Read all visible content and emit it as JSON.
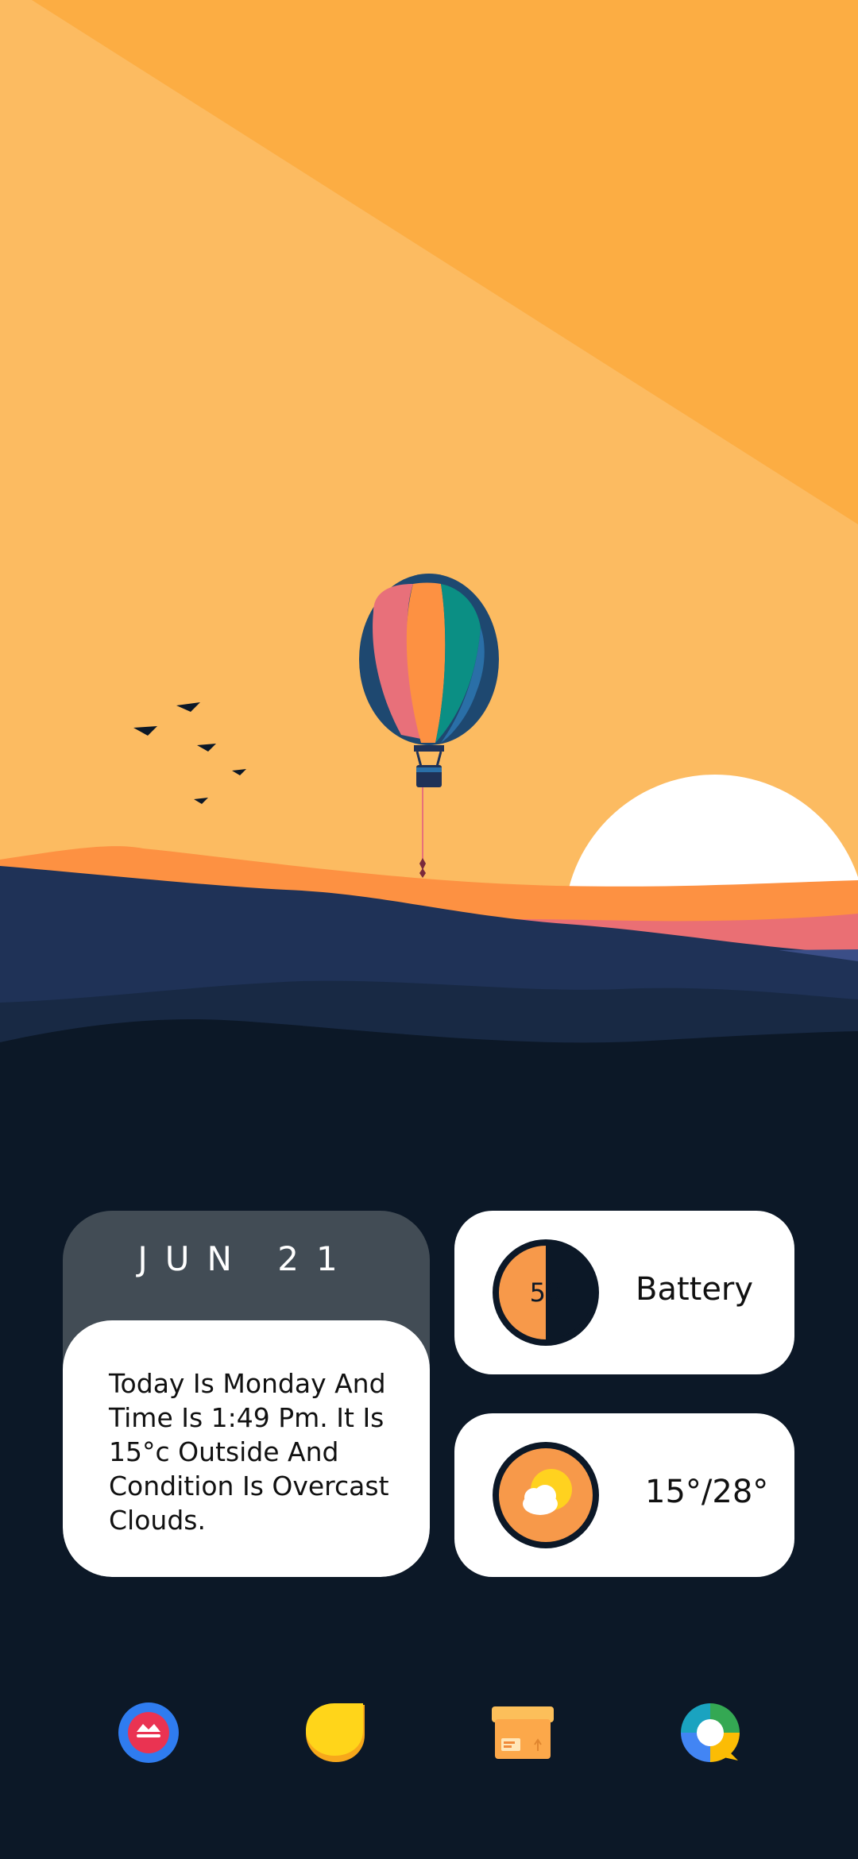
{
  "date_widget": {
    "date": "JUN 21",
    "summary": "Today Is Monday And Time Is 1:49 Pm. It Is 15°c Outside And Condition Is Overcast Clouds."
  },
  "battery_widget": {
    "level_percent": 50,
    "value": "50",
    "label": "Battery"
  },
  "weather_widget": {
    "icon": "partly-cloudy-icon",
    "temperature": "15°/28°"
  },
  "dock": {
    "apps": [
      {
        "icon": "red-circle-app-icon"
      },
      {
        "icon": "yellow-leaf-app-icon"
      },
      {
        "icon": "package-box-app-icon"
      },
      {
        "icon": "color-ring-chat-app-icon"
      }
    ]
  },
  "colors": {
    "background": "#0c1827",
    "accent_orange": "#f7994a",
    "widget_gray": "#424c55"
  }
}
